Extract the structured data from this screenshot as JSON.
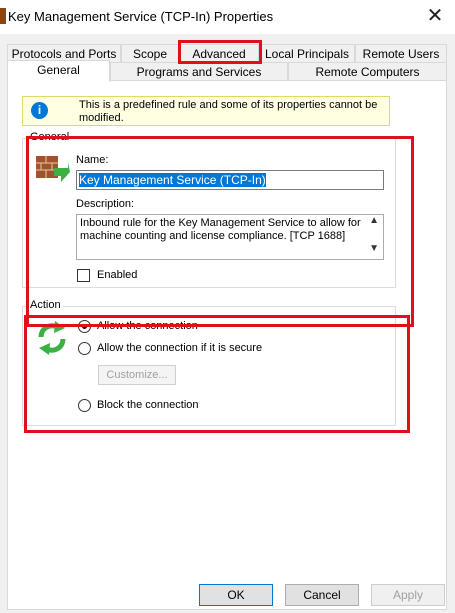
{
  "window": {
    "title": "Key Management Service (TCP-In) Properties"
  },
  "tabs": {
    "row1": [
      "Protocols and Ports",
      "Scope",
      "Advanced",
      "Local Principals",
      "Remote Users"
    ],
    "row2": [
      "General",
      "Programs and Services",
      "Remote Computers"
    ],
    "active": "General"
  },
  "info": {
    "text": "This is a predefined rule and some of its properties cannot be modified."
  },
  "general": {
    "group_label": "General",
    "name_label": "Name:",
    "name_value": "Key Management Service (TCP-In)",
    "description_label": "Description:",
    "description_value": "Inbound rule for the Key Management Service to allow for machine counting and license compliance. [TCP 1688]",
    "enabled_label": "Enabled",
    "enabled_checked": false
  },
  "action": {
    "group_label": "Action",
    "options": [
      "Allow the connection",
      "Allow the connection if it is secure",
      "Block the connection"
    ],
    "selected": "Allow the connection",
    "customize_label": "Customize..."
  },
  "buttons": {
    "ok": "OK",
    "cancel": "Cancel",
    "apply": "Apply"
  },
  "colors": {
    "accent": "#0078d7",
    "highlight_red": "#e0101a",
    "info_bg": "#ffffe1"
  }
}
